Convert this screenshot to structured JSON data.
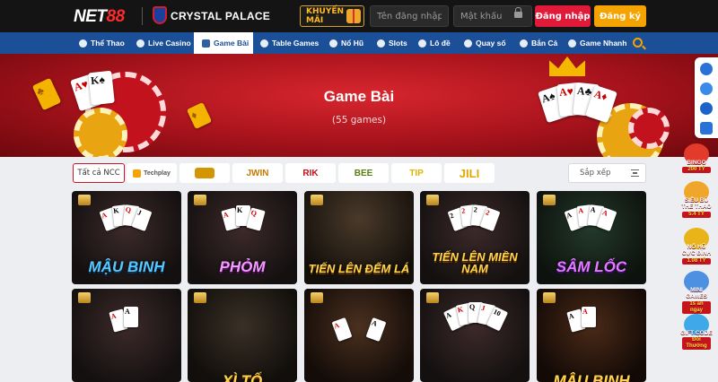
{
  "header": {
    "logo_prefix": "NET",
    "logo_suffix": "88",
    "partner_name": "CRYSTAL PALACE",
    "promo_label": "KHUYẾN MÃI",
    "username_placeholder": "Tên đăng nhập",
    "password_placeholder": "Mật khẩu",
    "login_label": "Đăng nhập",
    "register_label": "Đăng ký"
  },
  "nav": {
    "items": [
      {
        "label": "Thể Thao",
        "icon": "soccer-ball-icon"
      },
      {
        "label": "Live Casino",
        "icon": "roulette-icon"
      },
      {
        "label": "Game Bài",
        "icon": "cards-icon"
      },
      {
        "label": "Table Games",
        "icon": "table-icon"
      },
      {
        "label": "Nổ Hũ",
        "icon": "slot-jar-icon"
      },
      {
        "label": "Slots",
        "icon": "slots-icon"
      },
      {
        "label": "Lô đề",
        "icon": "lottery-icon"
      },
      {
        "label": "Quay số",
        "icon": "wheel-icon"
      },
      {
        "label": "Bắn Cá",
        "icon": "fish-icon"
      },
      {
        "label": "Game Nhanh",
        "icon": "rocket-icon"
      }
    ],
    "active_index": 2,
    "search_icon": "search-icon"
  },
  "banner": {
    "title": "Game Bài",
    "subtitle": "(55 games)"
  },
  "filters": {
    "all_label": "Tất cả NCC",
    "providers": [
      "Techplay",
      "",
      "JWIN",
      "RIK",
      "BEE",
      "TIP",
      "JILI"
    ],
    "sort_placeholder": "Sắp xếp"
  },
  "games": [
    {
      "title": "MẬU BINH"
    },
    {
      "title": "PHỎM"
    },
    {
      "title": "TIẾN LÊN ĐẾM LÁ"
    },
    {
      "title": "TIẾN LÊN MIỀN NAM"
    },
    {
      "title": "SÂM LỐC"
    },
    {
      "title": ""
    },
    {
      "title": "XÌ TỐ"
    },
    {
      "title": ""
    },
    {
      "title": ""
    },
    {
      "title": "MẬU BINH"
    }
  ],
  "side_promos": [
    {
      "label": "BINGO",
      "value": "200 TỶ"
    },
    {
      "label": "SIÊU BÙ THỂ THAO",
      "value": "5.4 TỶ"
    },
    {
      "label": "NỔ HŨ CỰC ĐỈNH",
      "value": "1.08 TỶ"
    },
    {
      "label": "MINI GAMES",
      "value": "1s ăn ngay"
    },
    {
      "label": "GIFT CODE",
      "value": "Đổi Thưởng"
    }
  ],
  "colors": {
    "brand_red": "#e21a3a",
    "nav_blue": "#1b4f97",
    "accent_gold": "#f5a300"
  }
}
